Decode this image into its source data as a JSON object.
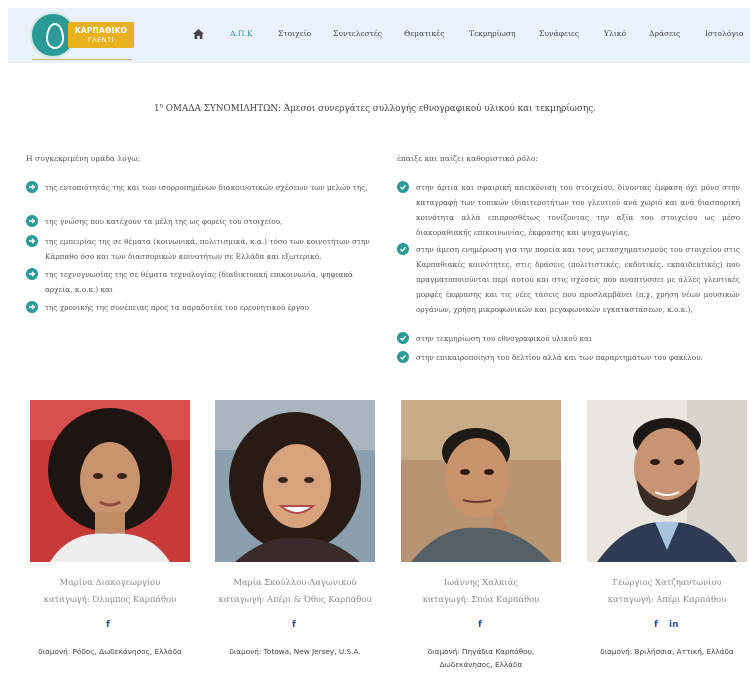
{
  "logo": {
    "line1": "ΚΑΡΠΑΘΙΚΟ",
    "line2": "ΓΛΕΝΤΙ"
  },
  "nav": {
    "items": [
      "Α.Π.Κ",
      "Στοιχείο",
      "Συντελεστές",
      "Θεματικές",
      "Τεκμηρίωση",
      "Συνάφειες",
      "Υλικό",
      "Δράσεις",
      "Ιστολόγιο"
    ]
  },
  "title": {
    "prefix": "1",
    "sup": "η",
    "text": " ΟΜΑΔΑ ΣΥΝΟΜΙΛΗΤΩΝ: Άμεσοι συνεργάτες συλλογής εθνογραφικού υλικού και τεκμηρίωσης."
  },
  "left": {
    "heading": "Η συγκεκριμένη ομάδα λόγω:",
    "bullets": [
      "της εντοπιότητάς της και των ισορροπημένων διακοινοτικών σχέσεων των μελών της,",
      "της γνώσης που κατέχουν τα μέλη της ως φορείς του στοιχείου,",
      "της εμπειρίας της σε θέματα (κοινωνικά, πολιτισμικά, κ.α.) τόσο των κοινοτήτων στην Κάρπαθο όσο και των διασπορικών κοινοτήτων σε Ελλάδα και εξωτερικό,",
      "της τεχνογνωσίας της σε θέματα τεχνολογίας (διαδικτυακή επικοινωνία, ψηφιακά αρχεία, κ.ο.κ.) και",
      "της χρονικής της συνέπειας προς τα παραδοτέα του ερευνητικού έργου"
    ]
  },
  "right": {
    "heading": "έπαιξε και παίζει καθοριστικό ρόλο:",
    "bullets": [
      "στην άρτια και σφαιρική απεικόνιση του στοιχείου, δίνοντας έμφαση όχι μόνο στην καταγραφή των τοπικών ιδιαιτεροτήτων του γλεντιού ανά χωριό και ανά διασπορική κοινότητα αλλά επιπροσθέτως τονίζοντας την αξία του στοιχείου ως μέσο διακοραθιακής επικοινωνίας, έκφρασης και ψυχαγωγίας,",
      "στην άμεση ενημέρωση για την πορεία και τους μετασχηματισμούς του στοιχείου στις Καρπαθιακές κοινότητες, στις δράσεις (πολιτιστικές, εκδοτικές, εκπαιδευτικές) που πραγματοποιούνται περί αυτού και στις σχέσεις που αναπτύσσει με άλλες γλεντικές μορφές έκφρασης και τις νέες τάσεις που προσλαμβάνει (π.χ. χρήση νέων μουσικών οργάνων, χρήση μικροφωνικών και μεγαφωνικών εγκαταστάσεων, κ.ο.κ.),",
      "στην τεκμηρίωση του εθνογραφικού υλικού και",
      "στην επικαιροποίηση του δελτίου αλλά και των παραρτημάτων του φακέλου."
    ]
  },
  "people": [
    {
      "name": "Μαρίνα Διακογεωργίου",
      "origin": "καταγωγή: Όλυμπος Καρπάθου",
      "social": [
        "f"
      ],
      "residence": [
        "διαμονή: Ρόδος, Δωδεκάνησος, Ελλάδα"
      ]
    },
    {
      "name": "Μαρία Σκούλλου-Λαγωνικού",
      "origin": "καταγωγή: Απέρι & Όθος Καρπάθου",
      "social": [
        "f"
      ],
      "residence": [
        "διαμονή: Totowa, New Jersey, U.S.A."
      ]
    },
    {
      "name": "Ιωάννης Χαλκιάς",
      "origin": "καταγωγή: Σπόα Καρπάθου",
      "social": [
        "f"
      ],
      "residence": [
        "διαμονή: Πηγάδια Καρπάθου,",
        "Δωδεκάνησος, Ελλάδα"
      ]
    },
    {
      "name": "Γεώργιος Χατζηαντωνίου",
      "origin": "καταγωγή: Απέρι Καρπάθου",
      "social": [
        "f",
        "in"
      ],
      "residence": [
        "διαμονή: Βριλήσσια, Αττική, Ελλάδα"
      ]
    }
  ],
  "colors": {
    "accent": "#2a9a96",
    "header_bg": "#e9f2fa",
    "logo_gold": "#e8b21f",
    "social_blue": "#2b4ea0"
  },
  "icons": {
    "home": "home-icon",
    "bullet_left": "arrow-circle-right-icon",
    "bullet_right": "check-circle-icon"
  }
}
